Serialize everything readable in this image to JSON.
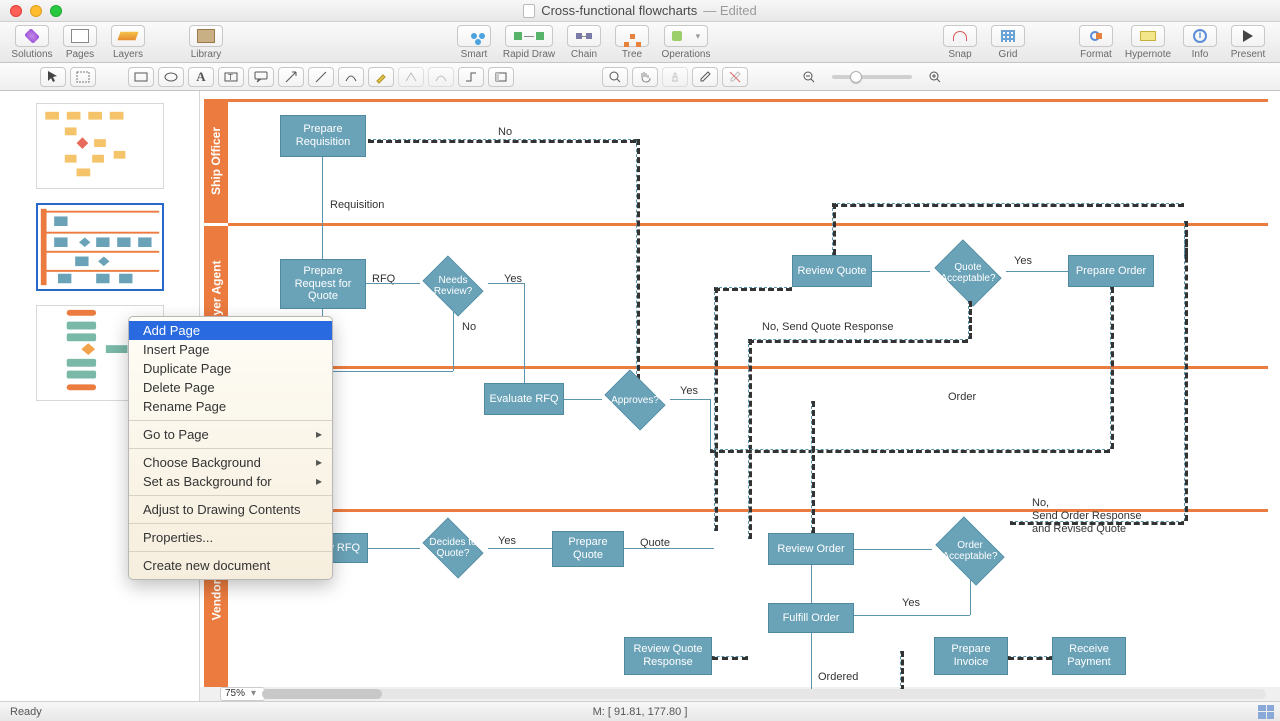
{
  "title": {
    "filename": "Cross-functional flowcharts",
    "status": "— Edited"
  },
  "toolbar": {
    "left": [
      "Solutions",
      "Pages",
      "Layers"
    ],
    "library": "Library",
    "center": [
      "Smart",
      "Rapid Draw",
      "Chain",
      "Tree",
      "Operations"
    ],
    "snapgrid": [
      "Snap",
      "Grid"
    ],
    "right": [
      "Format",
      "Hypernote",
      "Info",
      "Present"
    ]
  },
  "context_menu": {
    "items": [
      {
        "label": "Add Page",
        "sel": true
      },
      {
        "label": "Insert Page"
      },
      {
        "label": "Duplicate Page"
      },
      {
        "label": "Delete Page"
      },
      {
        "label": "Rename Page"
      },
      {
        "sep": true
      },
      {
        "label": "Go to Page",
        "submenu": true
      },
      {
        "sep": true
      },
      {
        "label": "Choose Background",
        "submenu": true
      },
      {
        "label": "Set as Background for",
        "submenu": true
      },
      {
        "sep": true
      },
      {
        "label": "Adjust to Drawing Contents"
      },
      {
        "sep": true
      },
      {
        "label": "Properties..."
      },
      {
        "sep": true
      },
      {
        "label": "Create new document"
      }
    ]
  },
  "lanes": [
    "Ship Officer",
    "Buyer Agent",
    "",
    "Vendor"
  ],
  "nodes": {
    "prep_req": "Prepare Requisition",
    "requisition": "Requisition",
    "prep_rfq": "Prepare Request for Quote",
    "rfq": "RFQ",
    "needs_review": "Needs Review?",
    "yes": "Yes",
    "no": "No",
    "eval_rfq": "Evaluate RFQ",
    "approves": "Approves?",
    "review_quote": "Review Quote",
    "quote_acc": "Quote Acceptable?",
    "prep_order": "Prepare Order",
    "no_send_quote": "No, Send Quote Response",
    "order": "Order",
    "w_rfq": "w RFQ",
    "decides": "Decides to Quote?",
    "prep_quote": "Prepare Quote",
    "quote": "Quote",
    "review_order": "Review Order",
    "order_acc": "Order Acceptable?",
    "no_send_order": "No,\nSend Order Response\nand Revised Quote",
    "fulfill": "Fulfill Order",
    "ordered": "Ordered",
    "prep_invoice": "Prepare Invoice",
    "recv_pay": "Receive Payment"
  },
  "zoom": "75%",
  "status": {
    "ready": "Ready",
    "mouse": "M: [ 91.81, 177.80 ]"
  }
}
